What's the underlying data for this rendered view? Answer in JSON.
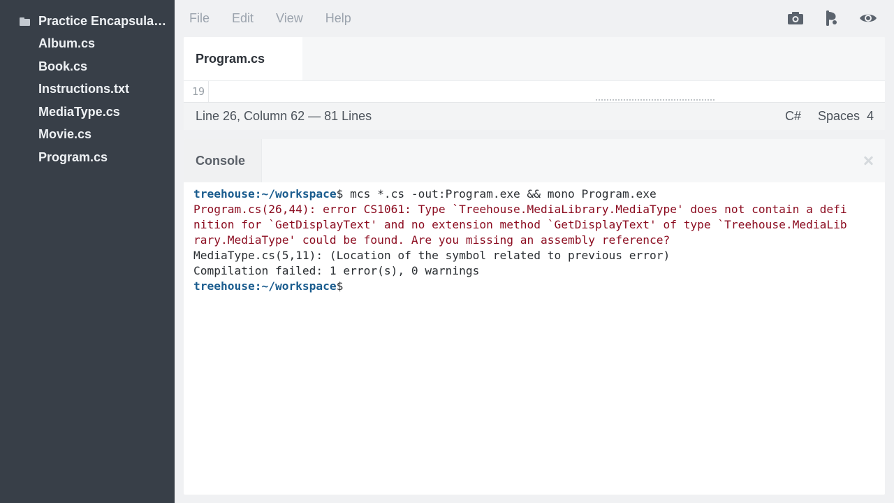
{
  "sidebar": {
    "folder": "Practice Encapsulation",
    "files": [
      "Album.cs",
      "Book.cs",
      "Instructions.txt",
      "MediaType.cs",
      "Movie.cs",
      "Program.cs"
    ]
  },
  "menu": {
    "file": "File",
    "edit": "Edit",
    "view": "View",
    "help": "Help"
  },
  "toolbar": {
    "icons": [
      "camera-icon",
      "share-icon",
      "eye-icon"
    ]
  },
  "editor": {
    "tab": "Program.cs",
    "line_number": "19",
    "status": {
      "position": "Line 26, Column 62 — 81 Lines",
      "language": "C#",
      "indent": "Spaces  4"
    }
  },
  "console": {
    "tab": "Console",
    "prompt": "treehouse:~/workspace",
    "command": "$ mcs *.cs -out:Program.exe && mono Program.exe",
    "error": "Program.cs(26,44): error CS1061: Type `Treehouse.MediaLibrary.MediaType' does not contain a definition for `GetDisplayText' and no extension method `GetDisplayText' of type `Treehouse.MediaLibrary.MediaType' could be found. Are you missing an assembly reference?",
    "location": "MediaType.cs(5,11): (Location of the symbol related to previous error)",
    "summary": "Compilation failed: 1 error(s), 0 warnings",
    "prompt_end": "$"
  },
  "colors": {
    "sidebar_bg": "#383f48",
    "prompt": "#1a5c8e",
    "error": "#8b0b1f"
  }
}
